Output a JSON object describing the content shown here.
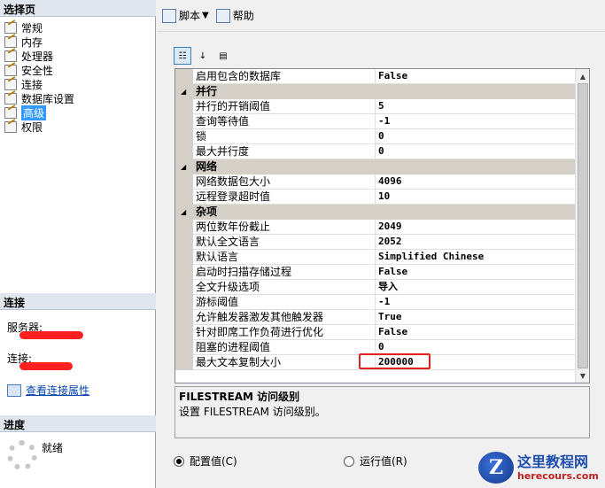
{
  "left": {
    "select_page_title": "选择页",
    "nav": [
      {
        "label": "常规",
        "selected": false
      },
      {
        "label": "内存",
        "selected": false
      },
      {
        "label": "处理器",
        "selected": false
      },
      {
        "label": "安全性",
        "selected": false
      },
      {
        "label": "连接",
        "selected": false
      },
      {
        "label": "数据库设置",
        "selected": false
      },
      {
        "label": "高级",
        "selected": true
      },
      {
        "label": "权限",
        "selected": false
      }
    ],
    "connection_title": "连接",
    "server_label": "服务器:",
    "connection_label": "连接:",
    "view_props_link": "查看连接属性",
    "progress_title": "进度",
    "progress_status": "就绪"
  },
  "toolbar": {
    "script_label": "脚本",
    "help_label": "帮助"
  },
  "grid": {
    "rows": [
      {
        "kind": "prop",
        "name": "启用包含的数据库",
        "value": "False"
      },
      {
        "kind": "cat",
        "name": "并行"
      },
      {
        "kind": "prop",
        "name": "并行的开销阈值",
        "value": "5"
      },
      {
        "kind": "prop",
        "name": "查询等待值",
        "value": "-1"
      },
      {
        "kind": "prop",
        "name": "锁",
        "value": "0"
      },
      {
        "kind": "prop",
        "name": "最大并行度",
        "value": "0"
      },
      {
        "kind": "cat",
        "name": "网络"
      },
      {
        "kind": "prop",
        "name": "网络数据包大小",
        "value": "4096"
      },
      {
        "kind": "prop",
        "name": "远程登录超时值",
        "value": "10"
      },
      {
        "kind": "cat",
        "name": "杂项"
      },
      {
        "kind": "prop",
        "name": "两位数年份截止",
        "value": "2049"
      },
      {
        "kind": "prop",
        "name": "默认全文语言",
        "value": "2052"
      },
      {
        "kind": "prop",
        "name": "默认语言",
        "value": "Simplified Chinese"
      },
      {
        "kind": "prop",
        "name": "启动时扫描存储过程",
        "value": "False"
      },
      {
        "kind": "prop",
        "name": "全文升级选项",
        "value": "导入"
      },
      {
        "kind": "prop",
        "name": "游标阈值",
        "value": "-1"
      },
      {
        "kind": "prop",
        "name": "允许触发器激发其他触发器",
        "value": "True"
      },
      {
        "kind": "prop",
        "name": "针对即席工作负荷进行优化",
        "value": "False"
      },
      {
        "kind": "prop",
        "name": "阻塞的进程阈值",
        "value": "0"
      },
      {
        "kind": "prop",
        "name": "最大文本复制大小",
        "value": "200000"
      }
    ]
  },
  "description": {
    "title": "FILESTREAM 访问级别",
    "text": "设置 FILESTREAM 访问级别。"
  },
  "radios": {
    "configured_label": "配置值(C)",
    "running_label": "运行值(R)",
    "configured_selected": true
  },
  "watermark": {
    "logo_letter": "Z",
    "site_name": "这里教程网",
    "site_url": "herecours.com"
  },
  "colors": {
    "selection": "#3399ff",
    "highlight_border": "#e02020",
    "category_bg": "#d4d0c8"
  }
}
